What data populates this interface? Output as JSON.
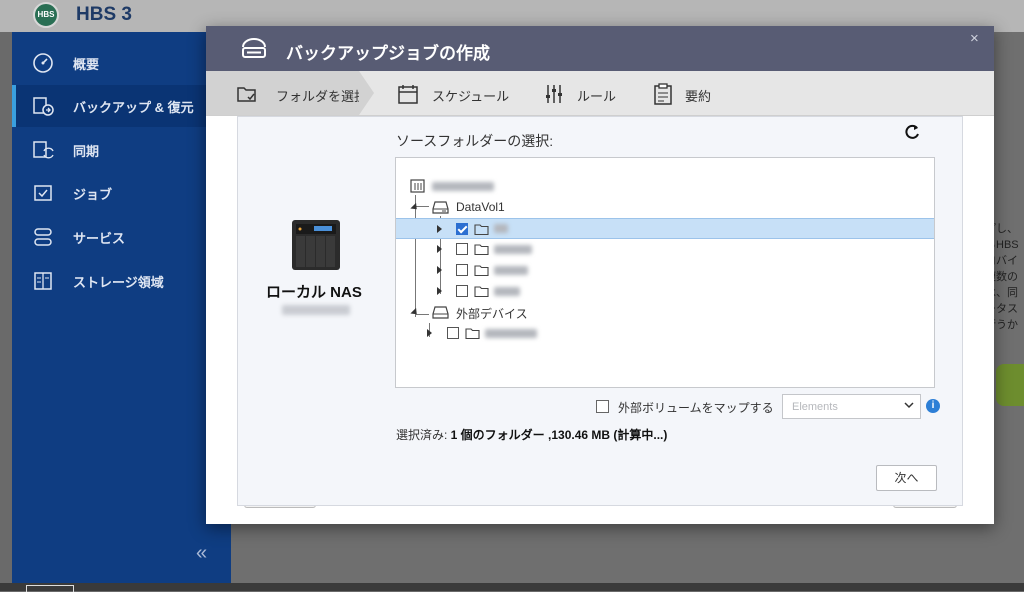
{
  "app": {
    "title": "HBS 3",
    "logo_text": "HBS"
  },
  "sidebar": {
    "items": [
      {
        "label": "概要",
        "icon": "gauge-icon"
      },
      {
        "label": "バックアップ & 復元",
        "icon": "backup-restore-icon",
        "active": true
      },
      {
        "label": "同期",
        "icon": "sync-icon"
      },
      {
        "label": "ジョブ",
        "icon": "job-icon"
      },
      {
        "label": "サービス",
        "icon": "services-icon"
      },
      {
        "label": "ストレージ領域",
        "icon": "storage-space-icon"
      }
    ],
    "collapse_glyph": "«"
  },
  "background_text_lines": [
    "プし、",
    "るHBS",
    "ロバイ",
    "複数の",
    "は、同",
    "ータス",
    "行うか"
  ],
  "dialog": {
    "title": "バックアップジョブの作成",
    "close_glyph": "×",
    "steps": [
      {
        "label": "フォルダを選択",
        "icon": "folder-select-icon",
        "active": true
      },
      {
        "label": "スケジュール",
        "icon": "calendar-icon"
      },
      {
        "label": "ルール",
        "icon": "sliders-icon"
      },
      {
        "label": "要約",
        "icon": "clipboard-icon"
      }
    ],
    "source_label": "ローカル NAS",
    "source_folder_label": "ソースフォルダーの選択:",
    "tree": {
      "volume_label": "DataVol1",
      "external_label": "外部デバイス",
      "folders": [
        {
          "checked": true
        },
        {
          "checked": false
        },
        {
          "checked": false
        },
        {
          "checked": false
        }
      ]
    },
    "map_external_label": "外部ボリュームをマップする",
    "select": {
      "placeholder": "Elements"
    },
    "info_glyph": "i",
    "summary": {
      "prefix": "選択済み: ",
      "bold": "1 個のフォルダー ,130.46 MB (計算中...)"
    },
    "next_button": "次へ"
  },
  "colors": {
    "sidebar_bg": "#0f3d82",
    "dialog_header_bg": "#585c74",
    "checkbox_checked": "#2c6fd1",
    "selected_row": "#c7e0f7"
  }
}
